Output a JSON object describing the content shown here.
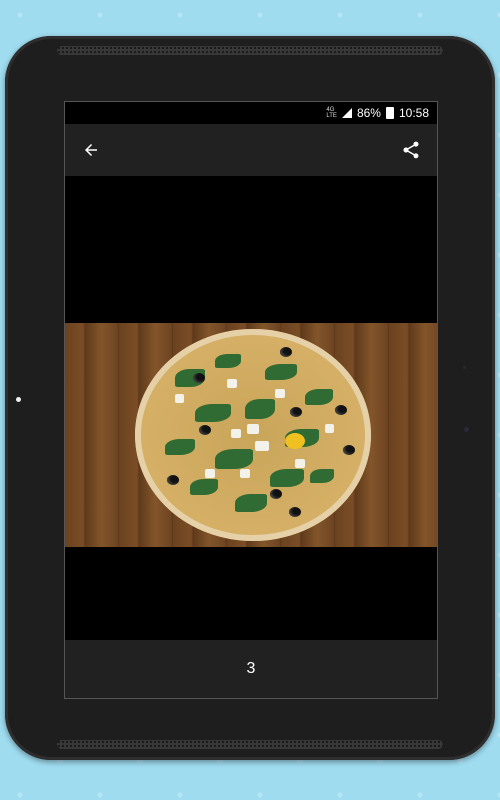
{
  "status_bar": {
    "network": "4G",
    "network_sub": "LTE",
    "battery": "86%",
    "time": "10:58"
  },
  "toolbar": {
    "back_icon": "arrow-left-icon",
    "share_icon": "share-icon"
  },
  "photo": {
    "subject": "pizza-with-spinach-feta-olives"
  },
  "footer": {
    "page_number": "3"
  },
  "colors": {
    "toolbar_bg": "#212121",
    "screen_bg": "#000000",
    "wallpaper": "#9fdcf0"
  }
}
